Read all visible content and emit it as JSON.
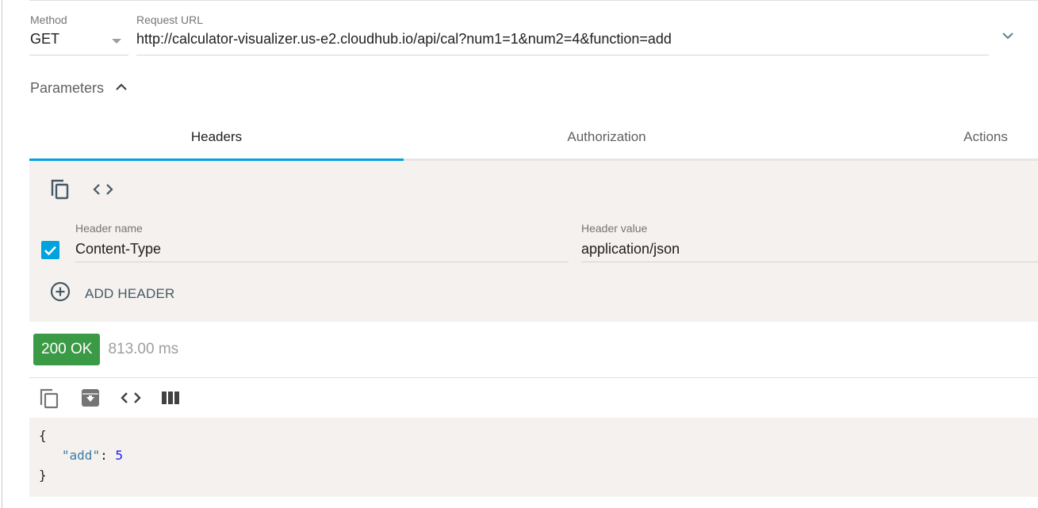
{
  "request": {
    "method_label": "Method",
    "method_value": "GET",
    "url_label": "Request URL",
    "url_value": "http://calculator-visualizer.us-e2.cloudhub.io/api/cal?num1=1&num2=4&function=add",
    "parameters_label": "Parameters"
  },
  "tabs": [
    {
      "label": "Headers",
      "active": true
    },
    {
      "label": "Authorization",
      "active": false
    },
    {
      "label": "Actions",
      "active": false
    }
  ],
  "headers_panel": {
    "name_label": "Header name",
    "value_label": "Header value",
    "rows": [
      {
        "enabled": true,
        "name": "Content-Type",
        "value": "application/json"
      }
    ],
    "add_header_label": "ADD HEADER"
  },
  "response": {
    "status": "200 OK",
    "time": "813.00 ms",
    "body": {
      "open_brace": "{",
      "key": "\"add\"",
      "colon": ": ",
      "value": "5",
      "close_brace": "}"
    }
  },
  "colors": {
    "accent": "#00a2df",
    "success": "#3b9a45",
    "panel_bg": "#f4f1ee",
    "json_key": "#3e7aa5",
    "json_number": "#1a1aff"
  },
  "icons": {
    "method_dropdown": "caret-down-icon",
    "expand": "chevron-down-icon",
    "parameters_toggle": "chevron-up-icon",
    "headers_copy": "copy-icon",
    "headers_code": "code-icon",
    "header_checkbox": "checkbox-checked-icon",
    "add_header": "add-circle-icon",
    "response_copy": "copy-icon",
    "response_save": "archive-download-icon",
    "response_code": "code-icon",
    "response_columns": "columns-icon"
  }
}
